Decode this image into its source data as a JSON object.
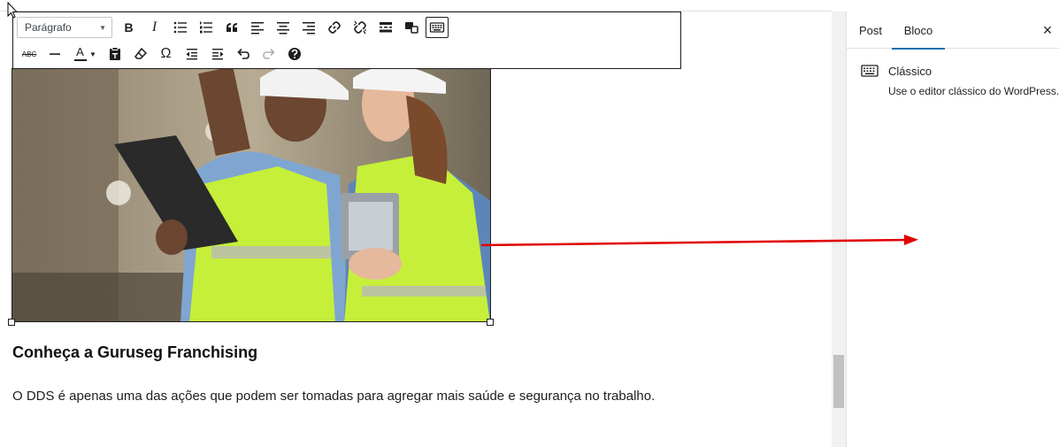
{
  "toolbar": {
    "format_select": "Parágrafo",
    "row1_icons": [
      "bold-icon",
      "italic-icon",
      "bullet-list-icon",
      "numbered-list-icon",
      "blockquote-icon",
      "align-left-icon",
      "align-center-icon",
      "align-right-icon",
      "link-icon",
      "unlink-icon",
      "read-more-icon",
      "toolbar-toggle-icon",
      "keyboard-icon"
    ],
    "row2_icons": [
      "strikethrough-icon",
      "horizontal-line-icon",
      "text-color-icon",
      "paste-text-icon",
      "clear-formatting-icon",
      "special-character-icon",
      "outdent-icon",
      "indent-icon",
      "undo-icon",
      "redo-icon",
      "help-icon"
    ],
    "bold_label": "B",
    "italic_label": "I",
    "strike_label": "ABC",
    "text_color_label": "A",
    "omega_label": "Ω"
  },
  "content": {
    "heading": "Conheça a Guruseg Franchising",
    "paragraph": "O DDS é apenas uma das ações que podem ser tomadas para agregar mais saúde e segurança no trabalho."
  },
  "sidebar": {
    "tabs": [
      {
        "label": "Post"
      },
      {
        "label": "Bloco"
      }
    ],
    "active_tab": "Bloco",
    "close_label": "×",
    "block": {
      "title": "Clássico",
      "description": "Use o editor clássico do WordPress."
    }
  },
  "colors": {
    "accent": "#2271b1",
    "annotation_arrow": "#e00000",
    "vest": "#c6ef3a"
  }
}
